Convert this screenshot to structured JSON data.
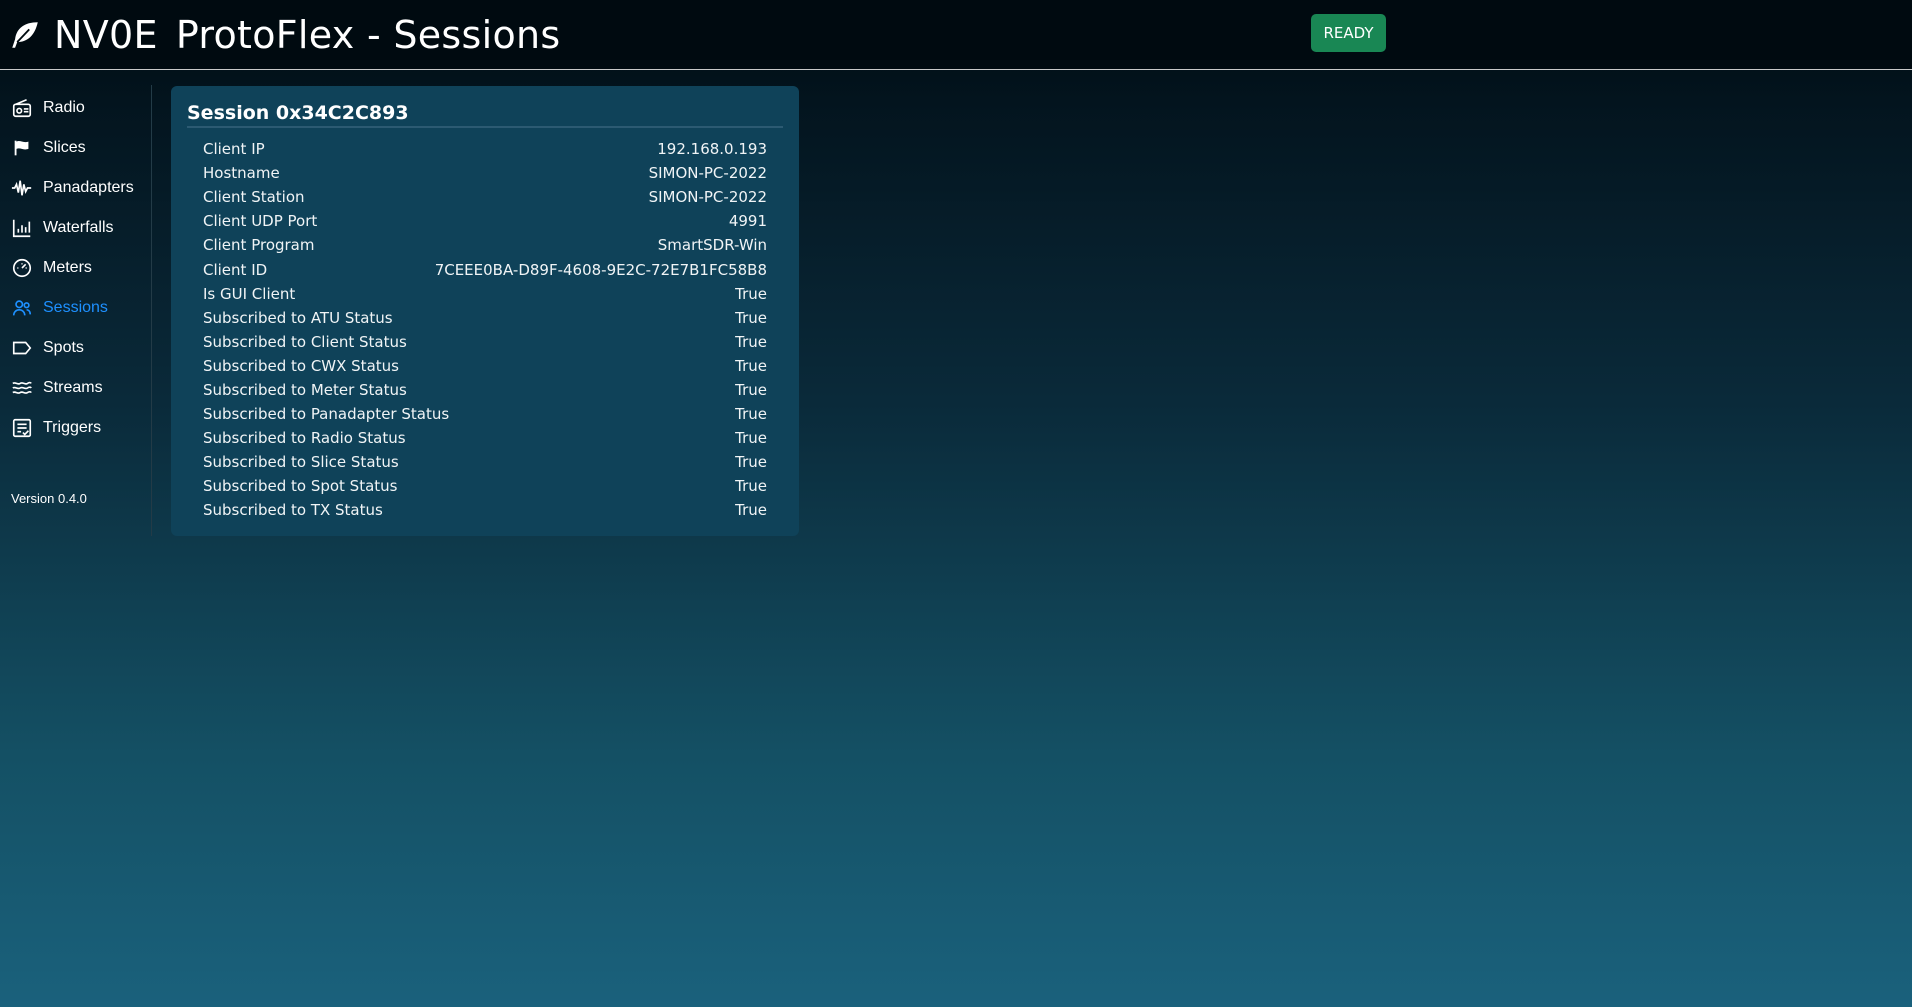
{
  "header": {
    "brand_callsign": "NV0E",
    "title": "ProtoFlex - Sessions",
    "status": "READY",
    "status_color": "#198754"
  },
  "sidebar": {
    "items": [
      {
        "label": "Radio",
        "icon": "radio-icon",
        "active": false
      },
      {
        "label": "Slices",
        "icon": "flag-icon",
        "active": false
      },
      {
        "label": "Panadapters",
        "icon": "waveform-icon",
        "active": false
      },
      {
        "label": "Waterfalls",
        "icon": "bar-chart-icon",
        "active": false
      },
      {
        "label": "Meters",
        "icon": "speedometer-icon",
        "active": false
      },
      {
        "label": "Sessions",
        "icon": "people-icon",
        "active": true
      },
      {
        "label": "Spots",
        "icon": "tag-icon",
        "active": false
      },
      {
        "label": "Streams",
        "icon": "waves-icon",
        "active": false
      },
      {
        "label": "Triggers",
        "icon": "list-check-icon",
        "active": false
      }
    ],
    "version": "Version 0.4.0",
    "accent_color": "#1e90ff"
  },
  "session": {
    "title": "Session 0x34C2C893",
    "rows": [
      {
        "label": "Client IP",
        "value": "192.168.0.193"
      },
      {
        "label": "Hostname",
        "value": "SIMON-PC-2022"
      },
      {
        "label": "Client Station",
        "value": "SIMON-PC-2022"
      },
      {
        "label": "Client UDP Port",
        "value": "4991"
      },
      {
        "label": "Client Program",
        "value": "SmartSDR-Win"
      },
      {
        "label": "Client ID",
        "value": "7CEEE0BA-D89F-4608-9E2C-72E7B1FC58B8"
      },
      {
        "label": "Is GUI Client",
        "value": "True"
      },
      {
        "label": "Subscribed to ATU Status",
        "value": "True"
      },
      {
        "label": "Subscribed to Client Status",
        "value": "True"
      },
      {
        "label": "Subscribed to CWX Status",
        "value": "True"
      },
      {
        "label": "Subscribed to Meter Status",
        "value": "True"
      },
      {
        "label": "Subscribed to Panadapter Status",
        "value": "True"
      },
      {
        "label": "Subscribed to Radio Status",
        "value": "True"
      },
      {
        "label": "Subscribed to Slice Status",
        "value": "True"
      },
      {
        "label": "Subscribed to Spot Status",
        "value": "True"
      },
      {
        "label": "Subscribed to TX Status",
        "value": "True"
      }
    ]
  }
}
